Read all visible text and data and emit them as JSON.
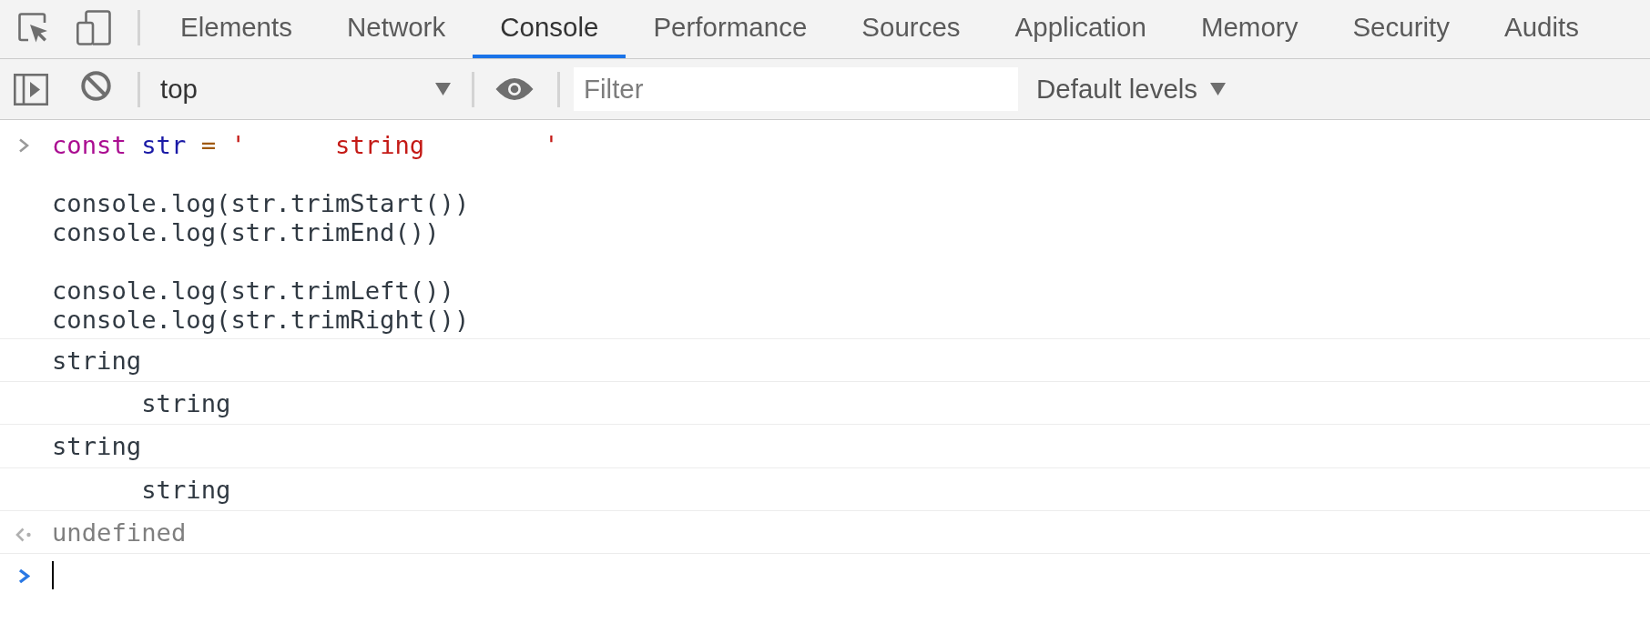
{
  "tabs": [
    {
      "label": "Elements",
      "selected": false
    },
    {
      "label": "Network",
      "selected": false
    },
    {
      "label": "Console",
      "selected": true
    },
    {
      "label": "Performance",
      "selected": false
    },
    {
      "label": "Sources",
      "selected": false
    },
    {
      "label": "Application",
      "selected": false
    },
    {
      "label": "Memory",
      "selected": false
    },
    {
      "label": "Security",
      "selected": false
    },
    {
      "label": "Audits",
      "selected": false
    }
  ],
  "console_toolbar": {
    "context_selector": {
      "value": "top"
    },
    "filter": {
      "placeholder": "Filter"
    },
    "levels_menu": {
      "label": "Default levels"
    }
  },
  "console": {
    "entries": [
      {
        "kind": "input",
        "groups": [
          {
            "lines": [
              {
                "tokens": [
                  {
                    "kind": "keyword",
                    "text": "const"
                  },
                  {
                    "kind": "variable",
                    "text": " str"
                  },
                  {
                    "kind": "operator",
                    "text": " ="
                  },
                  {
                    "kind": "string",
                    "text": " '      string        '"
                  }
                ]
              }
            ]
          },
          {
            "lines": [
              {
                "tokens": [
                  {
                    "kind": "plain",
                    "text": "console.log(str.trimStart())"
                  }
                ]
              },
              {
                "tokens": [
                  {
                    "kind": "plain",
                    "text": "console.log(str.trimEnd())"
                  }
                ]
              }
            ]
          },
          {
            "lines": [
              {
                "tokens": [
                  {
                    "kind": "plain",
                    "text": "console.log(str.trimLeft())"
                  }
                ]
              },
              {
                "tokens": [
                  {
                    "kind": "plain",
                    "text": "console.log(str.trimRight())"
                  }
                ]
              }
            ]
          }
        ]
      },
      {
        "kind": "log",
        "text": "string"
      },
      {
        "kind": "log",
        "text": "      string"
      },
      {
        "kind": "log",
        "text": "string"
      },
      {
        "kind": "log",
        "text": "      string"
      },
      {
        "kind": "result",
        "text": "undefined"
      },
      {
        "kind": "prompt",
        "focused": true
      }
    ]
  }
}
